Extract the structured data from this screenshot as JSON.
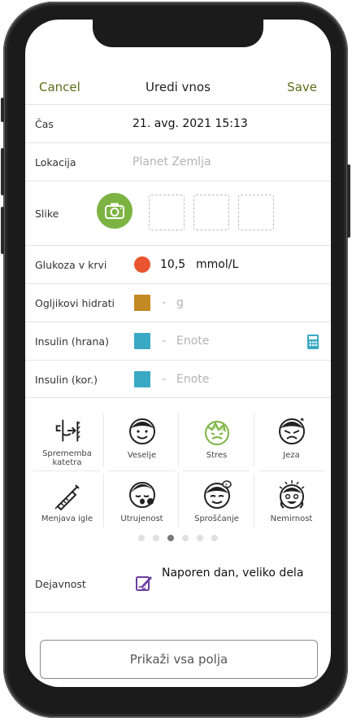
{
  "nav": {
    "cancel": "Cancel",
    "title": "Uredi vnos",
    "save": "Save"
  },
  "form": {
    "time": {
      "label": "Čas",
      "value": "21. avg. 2021 15:13"
    },
    "location": {
      "label": "Lokacija",
      "placeholder": "Planet Zemlja"
    },
    "images": {
      "label": "Slike"
    },
    "glucose": {
      "label": "Glukoza v krvi",
      "value": "10,5",
      "unit": "mmol/L",
      "color": "#e8542f"
    },
    "carbs": {
      "label": "Ogljikovi hidrati",
      "dash": "-",
      "unit": "g",
      "color": "#c28a22"
    },
    "insulin_food": {
      "label": "Insulin (hrana)",
      "dash": "-",
      "unit": "Enote",
      "color": "#3aa9c4"
    },
    "insulin_corr": {
      "label": "Insulin (kor.)",
      "dash": "-",
      "unit": "Enote",
      "color": "#3aa9c4"
    }
  },
  "moods": [
    {
      "label": "Sprememba\nkatetra",
      "icon": "catheter-icon"
    },
    {
      "label": "Veselje",
      "icon": "happy-face-icon"
    },
    {
      "label": "Stres",
      "icon": "stress-face-icon"
    },
    {
      "label": "Jeza",
      "icon": "angry-face-icon"
    },
    {
      "label": "Menjava igle",
      "icon": "needle-icon"
    },
    {
      "label": "Utrujenost",
      "icon": "tired-face-icon"
    },
    {
      "label": "Sproščanje",
      "icon": "relaxed-face-icon"
    },
    {
      "label": "Nemirnost",
      "icon": "anxious-face-icon"
    }
  ],
  "pager": {
    "count": 6,
    "active": 2
  },
  "activity": {
    "label": "Dejavnost",
    "value": "Naporen dan, veliko dela"
  },
  "show_all": "Prikaži vsa polja"
}
